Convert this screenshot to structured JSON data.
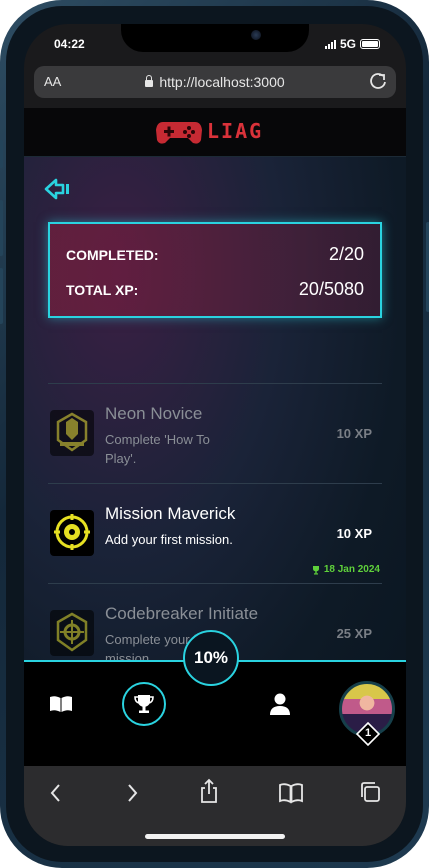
{
  "status": {
    "time": "04:22",
    "network": "5G"
  },
  "browser": {
    "text_size_label": "AA",
    "url": "http://localhost:3000"
  },
  "app": {
    "logo_text": "LIAG"
  },
  "stats": {
    "completed_label": "COMPLETED:",
    "completed_value": "2/20",
    "xp_label": "TOTAL XP:",
    "xp_value": "20/5080"
  },
  "achievements": [
    {
      "title": "Neon Novice",
      "description": "Complete 'How To Play'.",
      "xp": "10 XP",
      "date": "",
      "unlocked": false
    },
    {
      "title": "Mission Maverick",
      "description": "Add your first mission.",
      "xp": "10 XP",
      "date": "18 Jan 2024",
      "unlocked": true
    },
    {
      "title": "Codebreaker Initiate",
      "description": "Complete your first mission.",
      "xp": "25 XP",
      "date": "",
      "unlocked": false
    }
  ],
  "progress": {
    "label": "10%"
  },
  "player": {
    "level": "1"
  },
  "colors": {
    "accent": "#2ad3e0",
    "brand": "#d9323a",
    "date_green": "#5fd13b",
    "gold": "#d8d020"
  },
  "icons": {
    "back": "back-arrow-icon",
    "guide": "book-icon",
    "achievements": "trophy-icon",
    "profile": "user-icon",
    "browser_back": "chevron-left-icon",
    "browser_forward": "chevron-right-icon",
    "share": "share-icon",
    "bookmarks": "bookmarks-icon",
    "tabs": "tabs-icon"
  }
}
